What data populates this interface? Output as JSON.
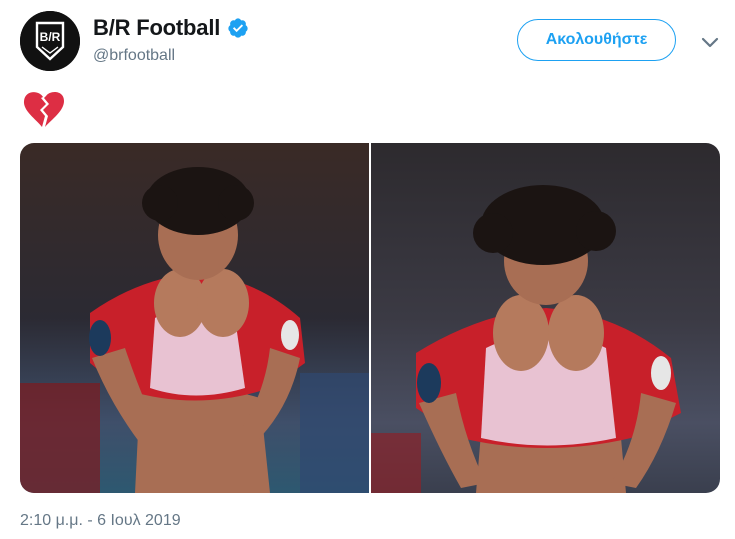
{
  "tweet": {
    "display_name": "B/R Football",
    "handle": "@brfootball",
    "verified": true,
    "follow_label": "Ακολουθήστε",
    "avatar_logo": "B/R",
    "text_emoji": "💔",
    "timestamp": "2:10 μ.μ. - 6 Ιουλ 2019",
    "media": [
      {
        "icon": "photo-player-wiping-face-left"
      },
      {
        "icon": "photo-player-wiping-face-right"
      }
    ]
  },
  "icons": {
    "verified": "verified-badge-icon",
    "caret": "chevron-down-icon",
    "emoji": "broken-heart-icon"
  },
  "colors": {
    "accent": "#1da1f2",
    "secondary_text": "#657786",
    "primary_text": "#14171a",
    "jersey_red": "#c8202a",
    "broken_heart": "#dd2e44"
  }
}
